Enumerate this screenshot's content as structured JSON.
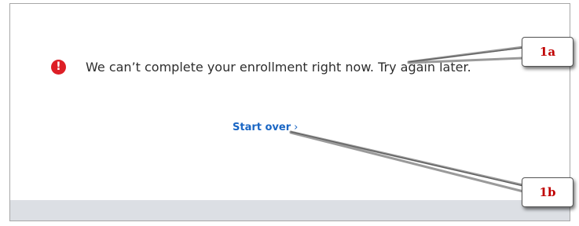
{
  "alert": {
    "icon": "exclamation-circle-icon",
    "message": "We can’t complete your enrollment right now. Try again later."
  },
  "link": {
    "label": "Start over",
    "chevron": "›"
  },
  "callouts": {
    "first": "1a",
    "second": "1b"
  },
  "colors": {
    "alert_icon": "#dd1f26",
    "link": "#1a66c4",
    "callout_text": "#c00000",
    "footer_strip": "#dcdfe4"
  }
}
